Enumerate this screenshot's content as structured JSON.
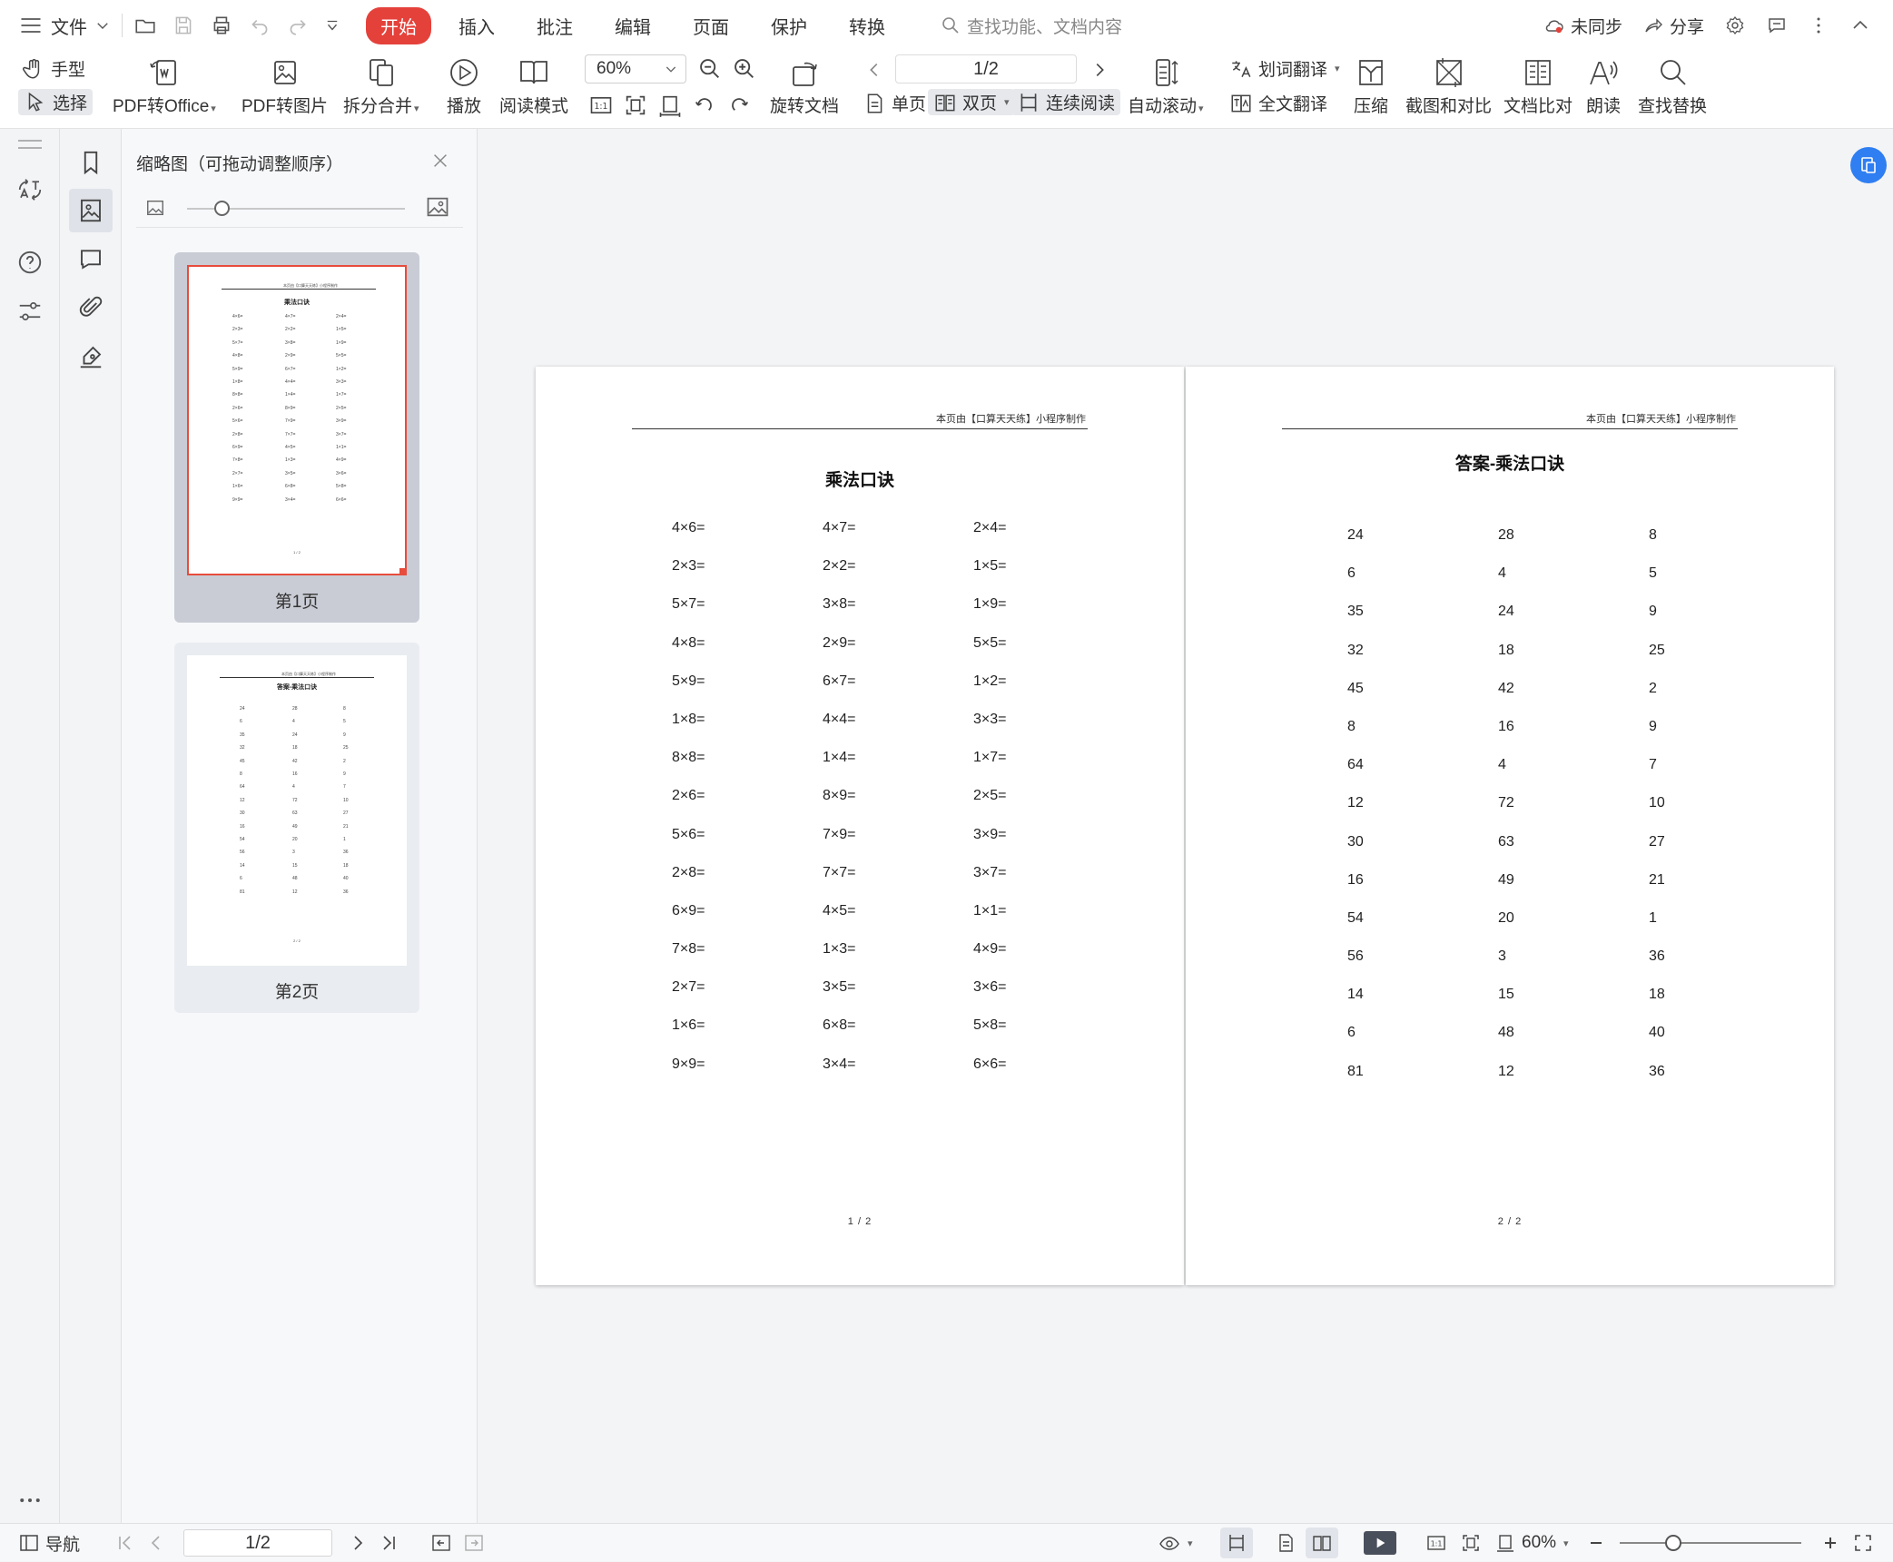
{
  "menubar": {
    "file_label": "文件",
    "tabs": [
      {
        "label": "开始",
        "active": true
      },
      {
        "label": "插入"
      },
      {
        "label": "批注"
      },
      {
        "label": "编辑"
      },
      {
        "label": "页面"
      },
      {
        "label": "保护"
      },
      {
        "label": "转换"
      }
    ],
    "search_placeholder": "查找功能、文档内容",
    "sync_label": "未同步",
    "share_label": "分享",
    "accent_color": "#e5413b"
  },
  "ribbon": {
    "hand_label": "手型",
    "select_label": "选择",
    "pdf_to_office": "PDF转Office",
    "pdf_to_image": "PDF转图片",
    "split_merge": "拆分合并",
    "play": "播放",
    "read_mode": "阅读模式",
    "zoom_value": "60%",
    "rotate_doc": "旋转文档",
    "page_indicator": "1/2",
    "single_page": "单页",
    "double_page": "双页",
    "continuous": "连续阅读",
    "auto_scroll": "自动滚动",
    "word_translate": "划词翻译",
    "full_translate": "全文翻译",
    "compress": "压缩",
    "screenshot_compare": "截图和对比",
    "doc_compare": "文档比对",
    "read_aloud": "朗读",
    "find_replace": "查找替换"
  },
  "thumbnails": {
    "title": "缩略图（可拖动调整顺序）",
    "pages": [
      {
        "label": "第1页",
        "selected": true
      },
      {
        "label": "第2页",
        "selected": false
      }
    ]
  },
  "document": {
    "header_text": "本页由【口算天天练】小程序制作",
    "page1": {
      "title": "乘法口诀",
      "col1": [
        "4×6=",
        "2×3=",
        "5×7=",
        "4×8=",
        "5×9=",
        "1×8=",
        "8×8=",
        "2×6=",
        "5×6=",
        "2×8=",
        "6×9=",
        "7×8=",
        "2×7=",
        "1×6=",
        "9×9="
      ],
      "col2": [
        "4×7=",
        "2×2=",
        "3×8=",
        "2×9=",
        "6×7=",
        "4×4=",
        "1×4=",
        "8×9=",
        "7×9=",
        "7×7=",
        "4×5=",
        "1×3=",
        "3×5=",
        "6×8=",
        "3×4="
      ],
      "col3": [
        "2×4=",
        "1×5=",
        "1×9=",
        "5×5=",
        "1×2=",
        "3×3=",
        "1×7=",
        "2×5=",
        "3×9=",
        "3×7=",
        "1×1=",
        "4×9=",
        "3×6=",
        "5×8=",
        "6×6="
      ],
      "footer": "1 / 2"
    },
    "page2": {
      "title": "答案-乘法口诀",
      "col1": [
        "24",
        "6",
        "35",
        "32",
        "45",
        "8",
        "64",
        "12",
        "30",
        "16",
        "54",
        "56",
        "14",
        "6",
        "81"
      ],
      "col2": [
        "28",
        "4",
        "24",
        "18",
        "42",
        "16",
        "4",
        "72",
        "63",
        "49",
        "20",
        "3",
        "15",
        "48",
        "12"
      ],
      "col3": [
        "8",
        "5",
        "9",
        "25",
        "2",
        "9",
        "7",
        "10",
        "27",
        "21",
        "1",
        "36",
        "18",
        "40",
        "36"
      ],
      "footer": "2 / 2"
    }
  },
  "statusbar": {
    "nav_label": "导航",
    "page_indicator": "1/2",
    "zoom_value": "60%"
  }
}
